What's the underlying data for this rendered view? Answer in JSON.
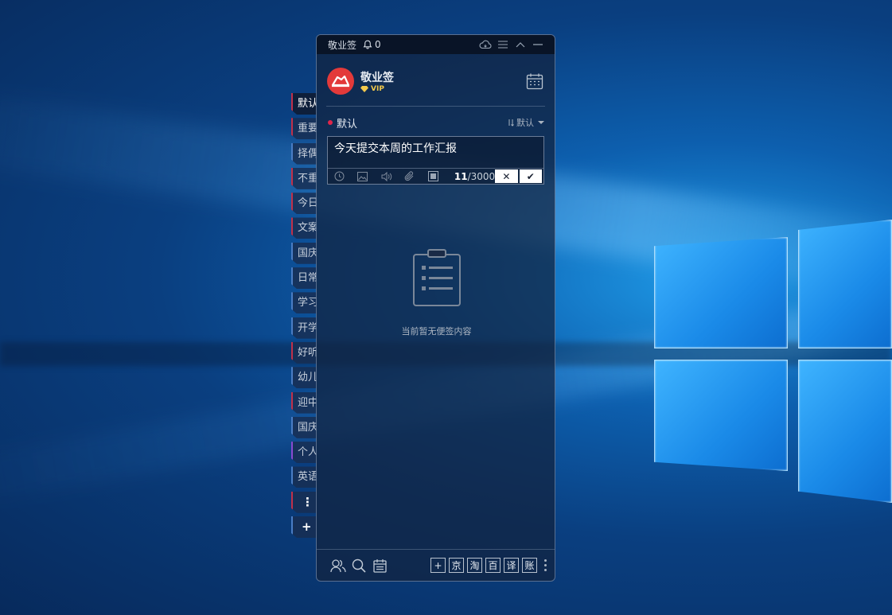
{
  "window": {
    "app_title": "敬业签",
    "notification_count": "0"
  },
  "user": {
    "name": "敬业签",
    "badge": "VIP"
  },
  "tabs": [
    {
      "label": "默认",
      "active": true
    },
    {
      "label": "重要"
    },
    {
      "label": "择偶"
    },
    {
      "label": "不重"
    },
    {
      "label": "今日"
    },
    {
      "label": "文案"
    },
    {
      "label": "国庆"
    },
    {
      "label": "日常"
    },
    {
      "label": "学习"
    },
    {
      "label": "开学"
    },
    {
      "label": "好听"
    },
    {
      "label": "幼儿"
    },
    {
      "label": "迎中"
    },
    {
      "label": "国庆"
    },
    {
      "label": "个人"
    },
    {
      "label": "英语"
    }
  ],
  "tab_more": "⋮",
  "tab_add": "+",
  "group": {
    "name": "默认",
    "sort_label": "默认"
  },
  "editor": {
    "text": "今天提交本周的工作汇报",
    "count": "11",
    "max": "/3000",
    "cancel": "✕",
    "confirm": "✔"
  },
  "empty_message": "当前暂无便签内容",
  "footer": {
    "quick_links": [
      "+",
      "京",
      "淘",
      "百",
      "译",
      "账"
    ]
  },
  "colors": {
    "accent_red": "#e0254a",
    "vip_gold": "#f2c94c",
    "avatar_red": "#e33a3a"
  }
}
